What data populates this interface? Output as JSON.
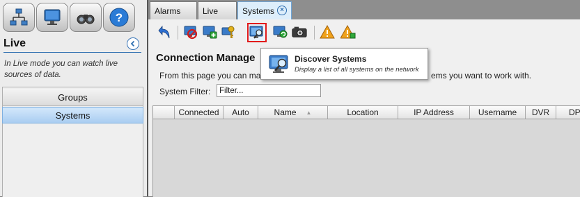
{
  "left_panel": {
    "title": "Live",
    "description": "In Live mode you can watch live sources of data.",
    "top_buttons": [
      {
        "icon": "network-icon"
      },
      {
        "icon": "monitor-icon"
      },
      {
        "icon": "binoculars-icon"
      },
      {
        "icon": "help-icon",
        "glyph": "?"
      }
    ],
    "nav": [
      {
        "label": "Groups",
        "selected": false
      },
      {
        "label": "Systems",
        "selected": true
      }
    ]
  },
  "tabs": [
    {
      "label": "Alarms"
    },
    {
      "label": "Live"
    },
    {
      "label": "Systems",
      "active": true,
      "close_glyph": "×"
    }
  ],
  "toolbar": {
    "icons": [
      "back-arrow-icon",
      "disconnect-system-icon",
      "add-system-icon",
      "key-icon",
      "discover-systems-icon",
      "refresh-system-icon",
      "camera-icon",
      "warning-icon",
      "warning-settings-icon"
    ]
  },
  "page": {
    "title": "Connection Manage",
    "description_left": "From this page you can ma",
    "description_right": "ems you want to work with.",
    "filter_label": "System Filter:",
    "filter_value": "Filter..."
  },
  "grid": {
    "columns": [
      "",
      "Connected",
      "Auto",
      "Name",
      "Location",
      "IP Address",
      "Username",
      "DVR",
      "DP"
    ],
    "sort_indicator": "▲"
  },
  "tooltip": {
    "title": "Discover Systems",
    "description": "Display a list of all systems on the network"
  },
  "colors": {
    "accent": "#2f6fb0",
    "highlight": "#e21b1b",
    "selected_nav": "#a9cdf1"
  }
}
